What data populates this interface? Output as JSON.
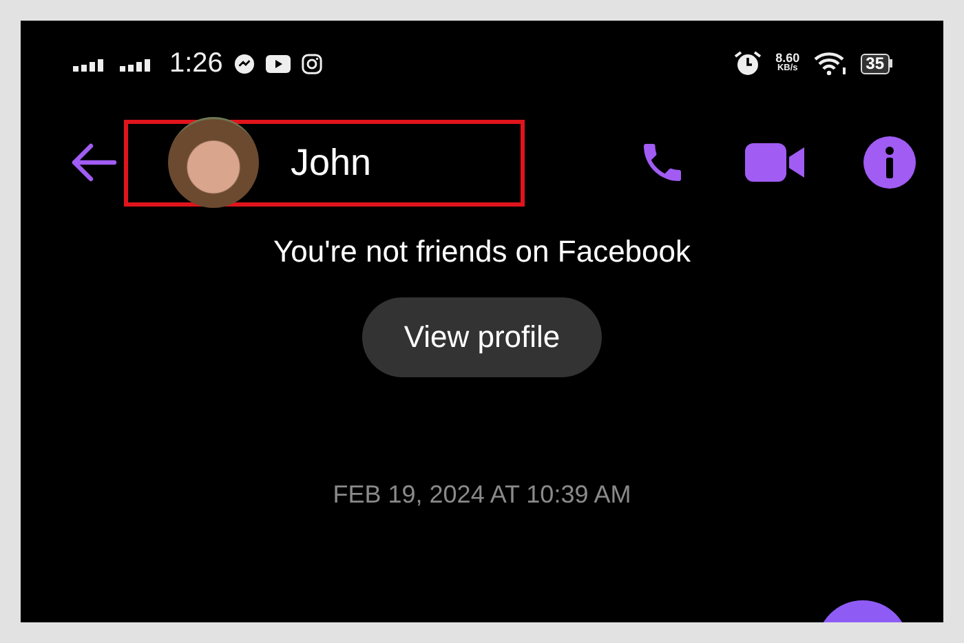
{
  "status_bar": {
    "time": "1:26",
    "net_speed": "8.60",
    "net_unit": "KB/s",
    "battery": "35"
  },
  "header": {
    "contact_name": "John",
    "highlighted": true
  },
  "notice": "You're not friends on Facebook",
  "profile_button": "View profile",
  "timestamp": "FEB 19, 2024 AT 10:39 AM"
}
